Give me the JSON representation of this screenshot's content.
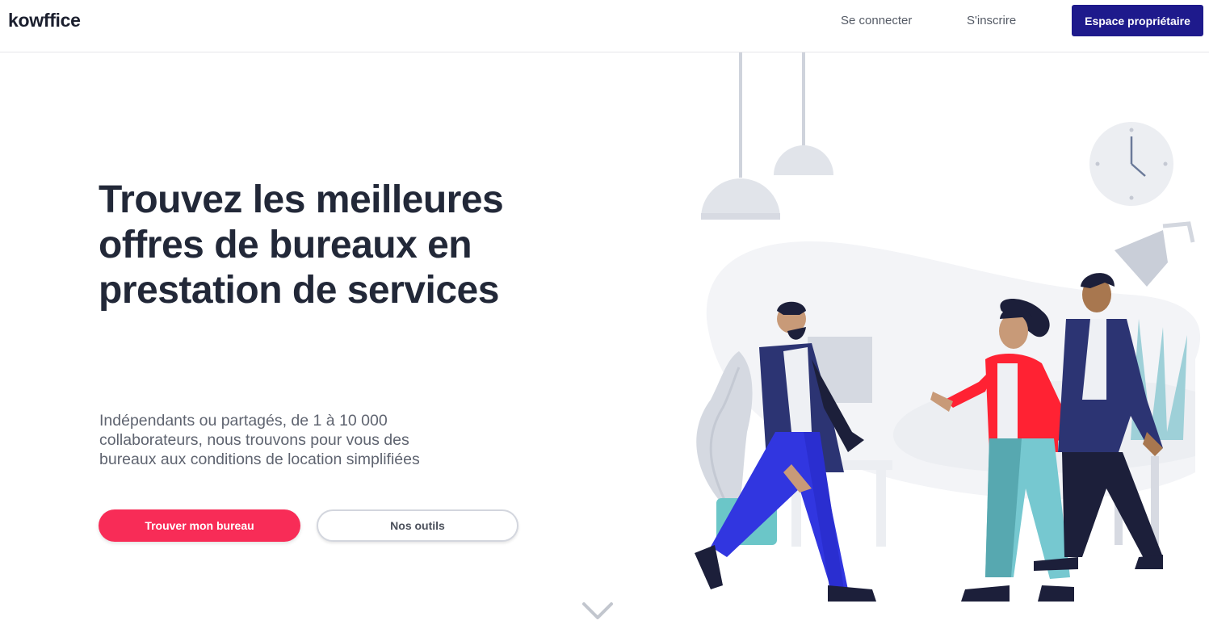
{
  "header": {
    "logo": "kowffice",
    "login_label": "Se connecter",
    "signup_label": "S'inscrire",
    "owner_button_label": "Espace propriétaire"
  },
  "hero": {
    "title": "Trouvez les meilleures offres de bureaux en prestation de services",
    "subtitle": "Indépendants ou partagés, de 1 à 10 000 collaborateurs, nous trouvons pour vous des bureaux aux conditions de location simplifiées",
    "primary_button_label": "Trouver mon bureau",
    "secondary_button_label": "Nos outils"
  },
  "illustration": {
    "subject": "people-walking-in-office",
    "icons": [
      "pendant-lamp-icon",
      "wall-clock-icon",
      "desk-lamp-icon",
      "potted-plant-icon"
    ]
  },
  "scroll_indicator": {
    "icon": "chevron-down-icon"
  },
  "colors": {
    "brand_navy": "#1e1a8c",
    "accent_red": "#f82c57",
    "title_text": "#222838",
    "subtitle_text": "#5f6470"
  }
}
